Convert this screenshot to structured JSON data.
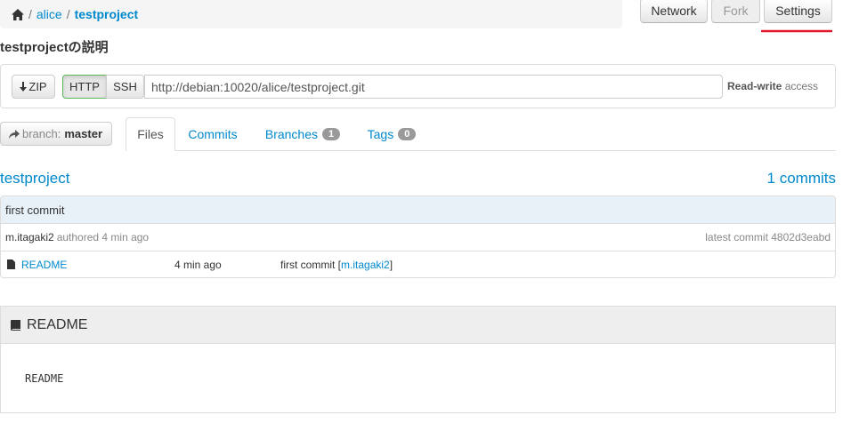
{
  "breadcrumb": {
    "user": "alice",
    "project": "testproject",
    "separator": "/"
  },
  "toolbar": {
    "network_label": "Network",
    "fork_label": "Fork",
    "settings_label": "Settings"
  },
  "annotation_color": "#e0182a",
  "page_title": "testprojectの説明",
  "clone": {
    "zip_label": "ZIP",
    "http_label": "HTTP",
    "ssh_label": "SSH",
    "url": "http://debian:10020/alice/testproject.git",
    "access_strong": "Read-write",
    "access_rest": "access"
  },
  "branch": {
    "label": "branch:",
    "value": "master"
  },
  "tabs": {
    "files": "Files",
    "commits": "Commits",
    "branches": "Branches",
    "branches_count": "1",
    "tags": "Tags",
    "tags_count": "0"
  },
  "repo": {
    "name": "testproject",
    "commit_count": "1 commits"
  },
  "latest": {
    "message": "first commit",
    "author": "m.itagaki2",
    "authored_text": "authored 4 min ago",
    "latest_commit": "latest commit 4802d3eabd"
  },
  "files": [
    {
      "name": "README",
      "age": "4 min ago",
      "message": "first commit",
      "author": "m.itagaki2"
    }
  ],
  "readme": {
    "title": "README",
    "content": "README"
  }
}
